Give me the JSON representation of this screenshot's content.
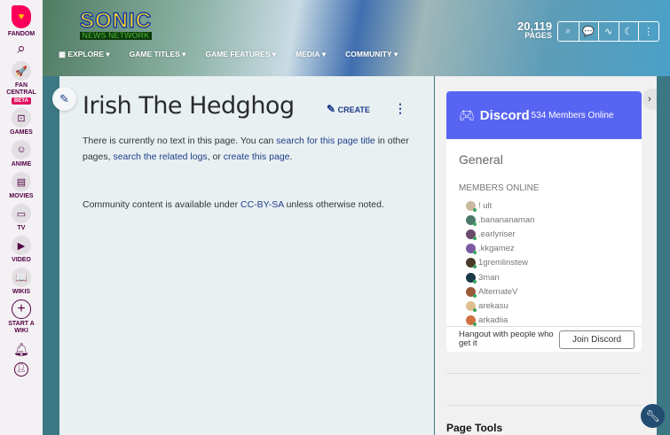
{
  "leftnav": {
    "brand": "FANDOM",
    "items": [
      {
        "label": "FAN CENTRAL",
        "badge": "BETA",
        "icon": "rocket-icon"
      },
      {
        "label": "GAMES",
        "icon": "gamepad-icon"
      },
      {
        "label": "ANIME",
        "icon": "anime-icon"
      },
      {
        "label": "MOVIES",
        "icon": "clapper-icon"
      },
      {
        "label": "TV",
        "icon": "tv-icon"
      },
      {
        "label": "VIDEO",
        "icon": "play-icon"
      },
      {
        "label": "WIKIS",
        "icon": "book-icon"
      },
      {
        "label": "START A WIKI",
        "icon": "plus-icon"
      }
    ]
  },
  "header": {
    "logo_top": "SONIC",
    "logo_bottom": "NEWS NETWORK",
    "nav": [
      "EXPLORE",
      "GAME TITLES",
      "GAME FEATURES",
      "MEDIA",
      "COMMUNITY"
    ],
    "page_count": "20,119",
    "page_label": "PAGES"
  },
  "page": {
    "title": "Irish The Hedghog",
    "create": "CREATE",
    "p1_a": "There is currently no text in this page. You can ",
    "link1": "search for this page title",
    "p1_b": " in other pages, ",
    "link2": "search the related logs",
    "p1_c": ", or ",
    "link3": "create this page",
    "p1_d": ".",
    "lic_a": "Community content is available under ",
    "lic_link": "CC-BY-SA",
    "lic_b": " unless otherwise noted."
  },
  "discord": {
    "brand": "Discord",
    "online": "534 Members Online",
    "channel": "General",
    "members_heading": "MEMBERS ONLINE",
    "members": [
      "! ult",
      ".banananaman",
      ".earlyriser",
      ".kkgamez",
      "1gremlinstew",
      "3man",
      "AlternateV",
      "arekasu",
      "arkadiia"
    ],
    "footer": "Hangout with people who get it",
    "join": "Join Discord",
    "color": "#5865f2"
  },
  "rail": {
    "page_tools": "Page Tools"
  }
}
